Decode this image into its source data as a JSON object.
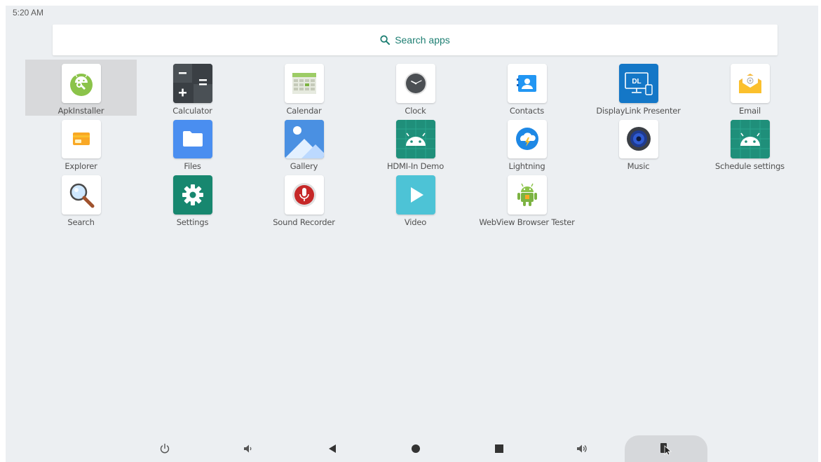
{
  "status": {
    "time": "5:20 AM"
  },
  "search": {
    "label": "Search apps",
    "icon": "search-icon"
  },
  "apps": [
    {
      "id": "apkinstaller",
      "label": "ApkInstaller",
      "selected": true
    },
    {
      "id": "calculator",
      "label": "Calculator"
    },
    {
      "id": "calendar",
      "label": "Calendar"
    },
    {
      "id": "clock",
      "label": "Clock"
    },
    {
      "id": "contacts",
      "label": "Contacts"
    },
    {
      "id": "displaylink",
      "label": "DisplayLink Presenter",
      "icon_text": "DL"
    },
    {
      "id": "email",
      "label": "Email"
    },
    {
      "id": "explorer",
      "label": "Explorer"
    },
    {
      "id": "files",
      "label": "Files"
    },
    {
      "id": "gallery",
      "label": "Gallery"
    },
    {
      "id": "hdmi",
      "label": "HDMI-In Demo"
    },
    {
      "id": "lightning",
      "label": "Lightning"
    },
    {
      "id": "music",
      "label": "Music"
    },
    {
      "id": "schedule",
      "label": "Schedule settings"
    },
    {
      "id": "search",
      "label": "Search"
    },
    {
      "id": "settings",
      "label": "Settings"
    },
    {
      "id": "soundrecorder",
      "label": "Sound Recorder"
    },
    {
      "id": "video",
      "label": "Video"
    },
    {
      "id": "webview",
      "label": "WebView Browser Tester"
    }
  ],
  "navbar": [
    {
      "id": "power",
      "icon": "power-icon"
    },
    {
      "id": "volume-down",
      "icon": "volume-down-icon"
    },
    {
      "id": "back",
      "icon": "back-icon"
    },
    {
      "id": "home",
      "icon": "home-icon"
    },
    {
      "id": "recents",
      "icon": "recents-icon"
    },
    {
      "id": "volume-up",
      "icon": "volume-up-icon"
    },
    {
      "id": "mouse-mode",
      "icon": "mouse-cursor-icon",
      "active": true
    }
  ],
  "colors": {
    "accent": "#1e7f73",
    "background": "#eceff2",
    "selected": "#d8d9db"
  }
}
